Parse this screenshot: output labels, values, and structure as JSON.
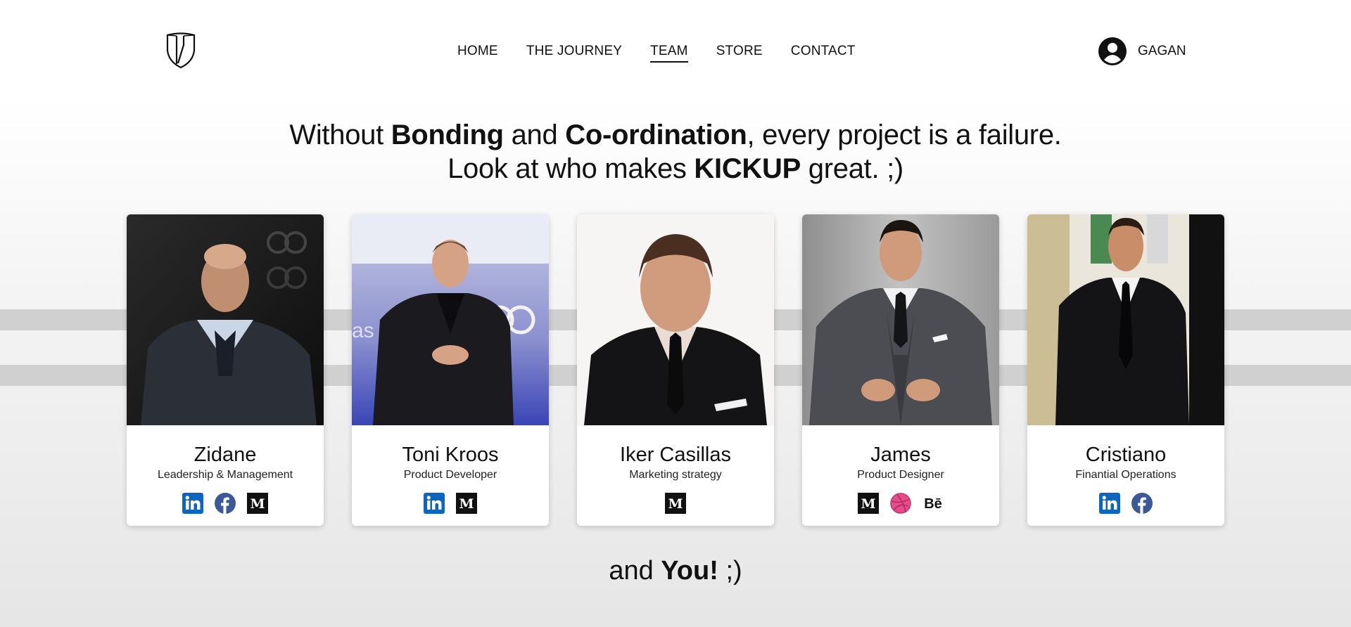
{
  "header": {
    "logo_icon": "shield-logo-icon",
    "nav": [
      {
        "label": "HOME"
      },
      {
        "label": "THE JOURNEY"
      },
      {
        "label": "TEAM"
      },
      {
        "label": "STORE"
      },
      {
        "label": "CONTACT"
      }
    ],
    "active_nav": "TEAM",
    "user": {
      "name": "GAGAN",
      "icon": "user-avatar-icon"
    }
  },
  "headline": {
    "line1_a": "Without ",
    "line1_b": "Bonding",
    "line1_c": " and ",
    "line1_d": "Co-ordination",
    "line1_e": ", every project is a failure.",
    "line2_a": "Look at who makes ",
    "line2_b": "KICKUP",
    "line2_c": " great. ;)"
  },
  "team": [
    {
      "name": "Zidane",
      "role": "Leadership & Management",
      "socials": [
        "linkedin",
        "facebook",
        "medium"
      ]
    },
    {
      "name": "Toni Kroos",
      "role": "Product Developer",
      "socials": [
        "linkedin",
        "medium"
      ]
    },
    {
      "name": "Iker Casillas",
      "role": "Marketing strategy",
      "socials": [
        "medium"
      ]
    },
    {
      "name": "James",
      "role": "Product Designer",
      "socials": [
        "medium",
        "dribbble",
        "behance"
      ]
    },
    {
      "name": "Cristiano",
      "role": "Finantial Operations",
      "socials": [
        "linkedin",
        "facebook"
      ]
    }
  ],
  "closing": {
    "a": "and ",
    "b": "You!",
    "c": " ;)"
  },
  "colors": {
    "linkedin": "#0a66c2",
    "facebook": "#3b5998",
    "medium": "#111111",
    "dribbble": "#e34d8a",
    "behance": "#111111",
    "stripe": "#d0d0d0"
  }
}
